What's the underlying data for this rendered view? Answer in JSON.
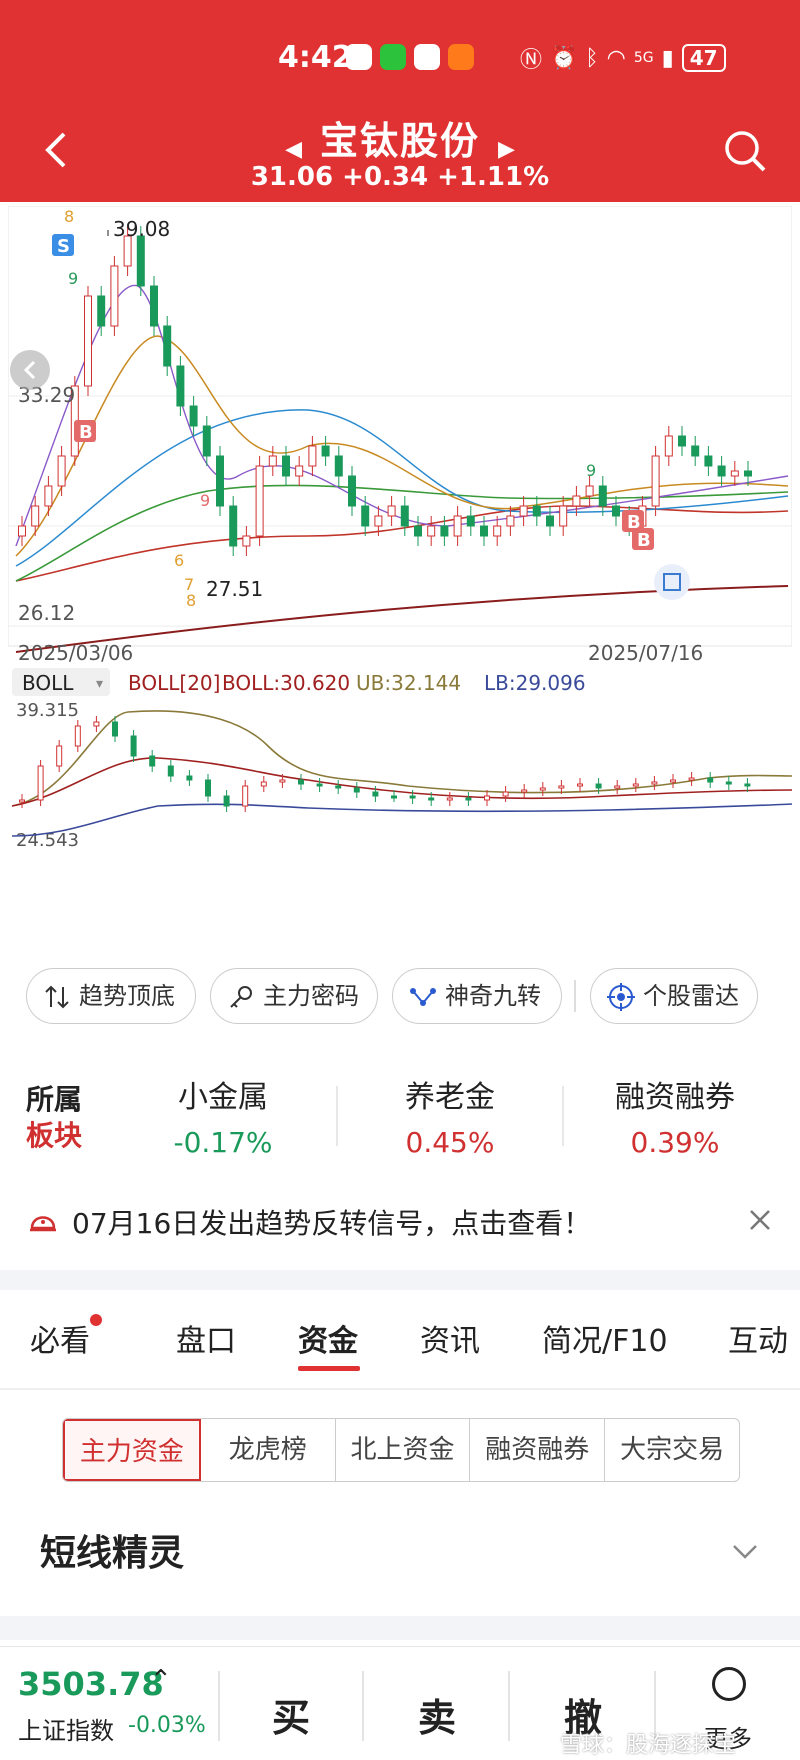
{
  "status": {
    "time": "4:42",
    "battery": "47",
    "signal": "5G"
  },
  "header": {
    "stock_name": "宝钛股份",
    "price": "31.06",
    "change": "+0.34",
    "pct": "+1.11%"
  },
  "kline": {
    "high_label": "39.08",
    "low_label": "27.51",
    "y_top": "33.29",
    "y_bottom": "26.12",
    "date_start": "2025/03/06",
    "date_end": "2025/07/16",
    "signals": [
      "S",
      "B",
      "B",
      "B"
    ],
    "counts": [
      "8",
      "7",
      "9",
      "6",
      "7",
      "8",
      "9",
      "9"
    ]
  },
  "boll": {
    "selector": "BOLL",
    "title": "BOLL[20]",
    "boll": "BOLL:30.620",
    "ub": "UB:32.144",
    "lb": "LB:29.096",
    "y_top": "39.315",
    "y_bottom": "24.543"
  },
  "tags": [
    {
      "label": "趋势顶底"
    },
    {
      "label": "主力密码"
    },
    {
      "label": "神奇九转"
    },
    {
      "label": "个股雷达"
    }
  ],
  "sector": {
    "label1": "所属",
    "label2": "板块",
    "items": [
      {
        "name": "小金属",
        "pct": "-0.17%",
        "color": "#1a9a5a"
      },
      {
        "name": "养老金",
        "pct": "0.45%",
        "color": "#d03030"
      },
      {
        "name": "融资融券",
        "pct": "0.39%",
        "color": "#d03030"
      }
    ]
  },
  "notice": {
    "text": "07月16日发出趋势反转信号，点击查看！"
  },
  "tabs": [
    "必看",
    "盘口",
    "资金",
    "资讯",
    "简况/F10",
    "互动"
  ],
  "active_tab": "资金",
  "subtabs": [
    "主力资金",
    "龙虎榜",
    "北上资金",
    "融资融券",
    "大宗交易"
  ],
  "section": {
    "title": "短线精灵"
  },
  "bottom": {
    "index_value": "3503.78",
    "index_name": "上证指数",
    "index_change": "-0.03%",
    "buy": "买",
    "sell": "卖",
    "cancel": "撤",
    "more": "更多",
    "watermark": "雪球：股海逐探宝"
  },
  "colors": {
    "brand": "#e03232",
    "up": "#d03030",
    "down": "#1a9a5a"
  }
}
